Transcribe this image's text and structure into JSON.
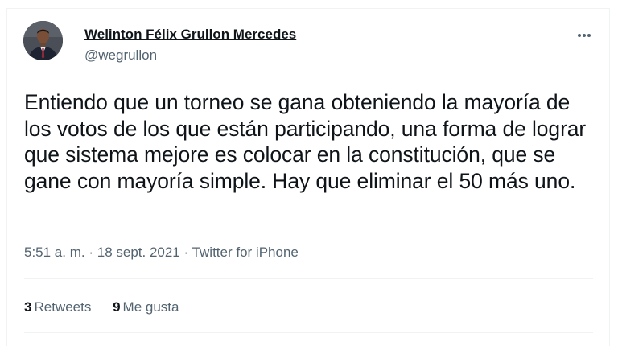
{
  "tweet": {
    "author_name": "Welinton Félix Grullon Mercedes",
    "author_handle": "@wegrullon",
    "text": "Entiendo que un torneo se gana obteniendo la mayoría de los votos de los que están participando, una forma de lograr que sistema mejore es colocar en la constitución, que se gane con mayoría simple. Hay que eliminar el 50 más uno.",
    "time": "5:51 a. m.",
    "separator": "·",
    "date": "18 sept. 2021",
    "source": "Twitter for iPhone"
  },
  "stats": {
    "retweets_count": "3",
    "retweets_label": "Retweets",
    "likes_count": "9",
    "likes_label": "Me gusta"
  },
  "icons": {
    "avatar": "profile-photo",
    "more": "more-options-icon"
  },
  "colors": {
    "text_primary": "#0f1419",
    "text_secondary": "#536471",
    "border": "#eff3f4"
  }
}
